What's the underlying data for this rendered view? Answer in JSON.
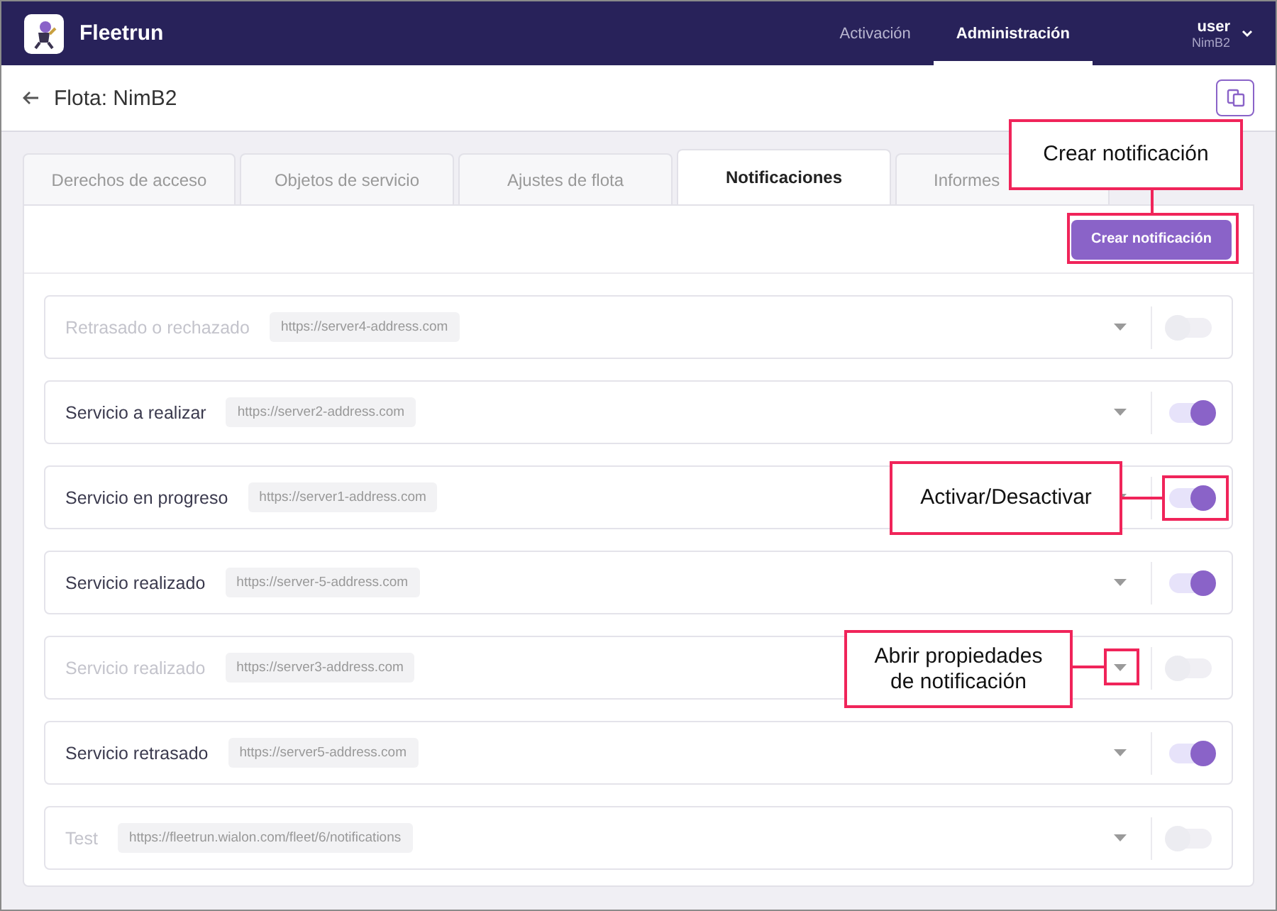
{
  "app": {
    "name": "Fleetrun"
  },
  "nav": [
    {
      "label": "Activación",
      "selected": false
    },
    {
      "label": "Administración",
      "selected": true
    }
  ],
  "user": {
    "name": "user",
    "fleet": "NimB2"
  },
  "page": {
    "title": "Flota: NimB2"
  },
  "tabs": [
    {
      "label": "Derechos de acceso",
      "selected": false
    },
    {
      "label": "Objetos de servicio",
      "selected": false
    },
    {
      "label": "Ajustes de flota",
      "selected": false
    },
    {
      "label": "Notificaciones",
      "selected": true
    },
    {
      "label": "Informes",
      "selected": false
    }
  ],
  "create_button": "Crear notificación",
  "notifications": [
    {
      "name": "Retrasado o rechazado",
      "url": "https://server4-address.com",
      "on": false
    },
    {
      "name": "Servicio a realizar",
      "url": "https://server2-address.com",
      "on": true
    },
    {
      "name": "Servicio en progreso",
      "url": "https://server1-address.com",
      "on": true
    },
    {
      "name": "Servicio realizado",
      "url": "https://server-5-address.com",
      "on": true
    },
    {
      "name": "Servicio realizado",
      "url": "https://server3-address.com",
      "on": false
    },
    {
      "name": "Servicio retrasado",
      "url": "https://server5-address.com",
      "on": true
    },
    {
      "name": "Test",
      "url": "https://fleetrun.wialon.com/fleet/6/notifications",
      "on": false
    }
  ],
  "annotations": [
    {
      "kind": "create",
      "text": "Crear notificación"
    },
    {
      "kind": "toggle",
      "text": "Activar/Desactivar"
    },
    {
      "kind": "caret",
      "text": "Abrir propiedades de notificación"
    }
  ]
}
